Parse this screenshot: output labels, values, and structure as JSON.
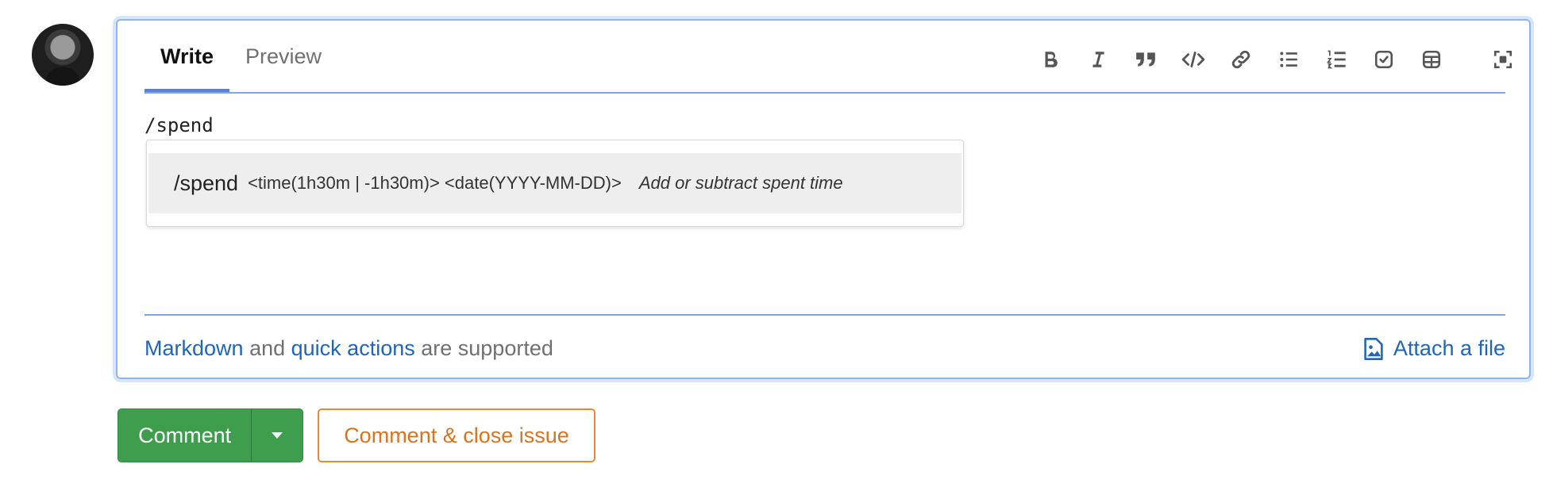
{
  "tabs": [
    {
      "label": "Write",
      "active": true
    },
    {
      "label": "Preview",
      "active": false
    }
  ],
  "toolbar": [
    {
      "icon": "bold-icon"
    },
    {
      "icon": "italic-icon"
    },
    {
      "icon": "quote-icon"
    },
    {
      "icon": "code-icon"
    },
    {
      "icon": "link-icon"
    },
    {
      "icon": "bullet-list-icon"
    },
    {
      "icon": "numbered-list-icon"
    },
    {
      "icon": "task-list-icon"
    },
    {
      "icon": "table-icon"
    },
    {
      "icon": "fullscreen-icon"
    }
  ],
  "editor": {
    "value": "/spend"
  },
  "suggestion": {
    "command": "/spend",
    "params": "<time(1h30m | -1h30m)> <date(YYYY-MM-DD)>",
    "description": "Add or subtract spent time"
  },
  "footer": {
    "markdown_link": "Markdown",
    "and_text": "and",
    "quick_actions_link": "quick actions",
    "supported_text": "are supported",
    "attach_label": "Attach a file"
  },
  "actions": {
    "comment_label": "Comment",
    "close_label": "Comment & close issue"
  },
  "colors": {
    "accent": "#1f65b8",
    "comment_green": "#3f9e4e",
    "close_orange": "#d8741f",
    "focus_border": "#8fb5ec"
  }
}
